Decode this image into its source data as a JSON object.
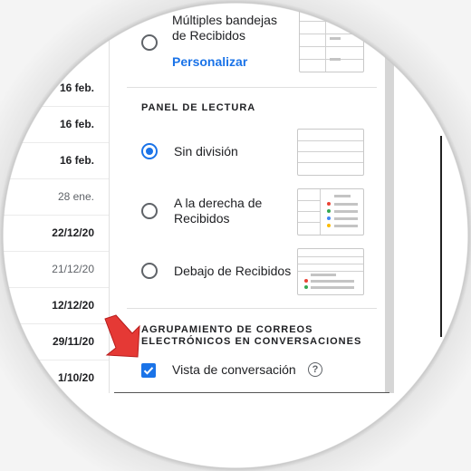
{
  "email_list": {
    "dates": [
      {
        "text": "16 feb.",
        "style": "bold"
      },
      {
        "text": "16 feb.",
        "style": "bold"
      },
      {
        "text": "16 feb.",
        "style": "bold"
      },
      {
        "text": "28 ene.",
        "style": "light"
      },
      {
        "text": "22/12/20",
        "style": "bold"
      },
      {
        "text": "21/12/20",
        "style": "light"
      },
      {
        "text": "12/12/20",
        "style": "bold"
      },
      {
        "text": "29/11/20",
        "style": "bold"
      },
      {
        "text": "1/10/20",
        "style": "bold"
      }
    ]
  },
  "inbox_types": {
    "multiple_label_line1": "Múltiples bandejas",
    "multiple_label_line2": "de Recibidos",
    "customize_link": "Personalizar"
  },
  "reading_pane": {
    "title": "PANEL DE LECTURA",
    "options": {
      "no_split": "Sin división",
      "right_line1": "A la derecha de",
      "right_line2": "Recibidos",
      "below": "Debajo de Recibidos"
    },
    "selected": "no_split"
  },
  "grouping": {
    "title_line1": "AGRUPAMIENTO DE CORREOS",
    "title_line2": "ELECTRÓNICOS EN CONVERSACIONES",
    "conversation_view_label": "Vista de conversación",
    "conversation_view_checked": true,
    "help_glyph": "?"
  },
  "colors": {
    "accent": "#1a73e8",
    "annotation_arrow": "#e53935",
    "dot_red": "#ea4335",
    "dot_green": "#34a853",
    "dot_blue": "#4285f4",
    "dot_yellow": "#fbbc04"
  }
}
